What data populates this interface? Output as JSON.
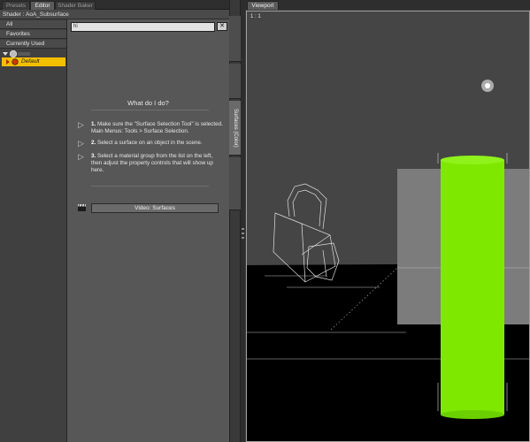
{
  "tabs": [
    {
      "label": "Presets",
      "active": false
    },
    {
      "label": "Editor",
      "active": true
    },
    {
      "label": "Shader Baker",
      "active": false
    }
  ],
  "shader_line": "Shader : AoA_Subsurface",
  "filters": [
    "All",
    "Favorites",
    "Currently Used"
  ],
  "tree": {
    "selected_label": "Default"
  },
  "search": {
    "value": "hi"
  },
  "help": {
    "title": "What do I do?",
    "steps": [
      {
        "num": "1.",
        "text": "Make sure the \"Surface Selection Tool\" is selected. Main Menus: Tools > Surface Selection."
      },
      {
        "num": "2.",
        "text": "Select a surface on an object in the scene."
      },
      {
        "num": "3.",
        "text": "Select a material group from the list on the left, then adjust the property controls that will show up here."
      }
    ],
    "video_button": "Video: Surfaces"
  },
  "side_tabs": [
    "Surfaces (Color)"
  ],
  "viewport": {
    "tab_label": "Viewport",
    "corner_label": "1 : 1"
  },
  "colors": {
    "selection": "#f3c000",
    "cylinder": "#7fe800",
    "floor": "#000000"
  }
}
